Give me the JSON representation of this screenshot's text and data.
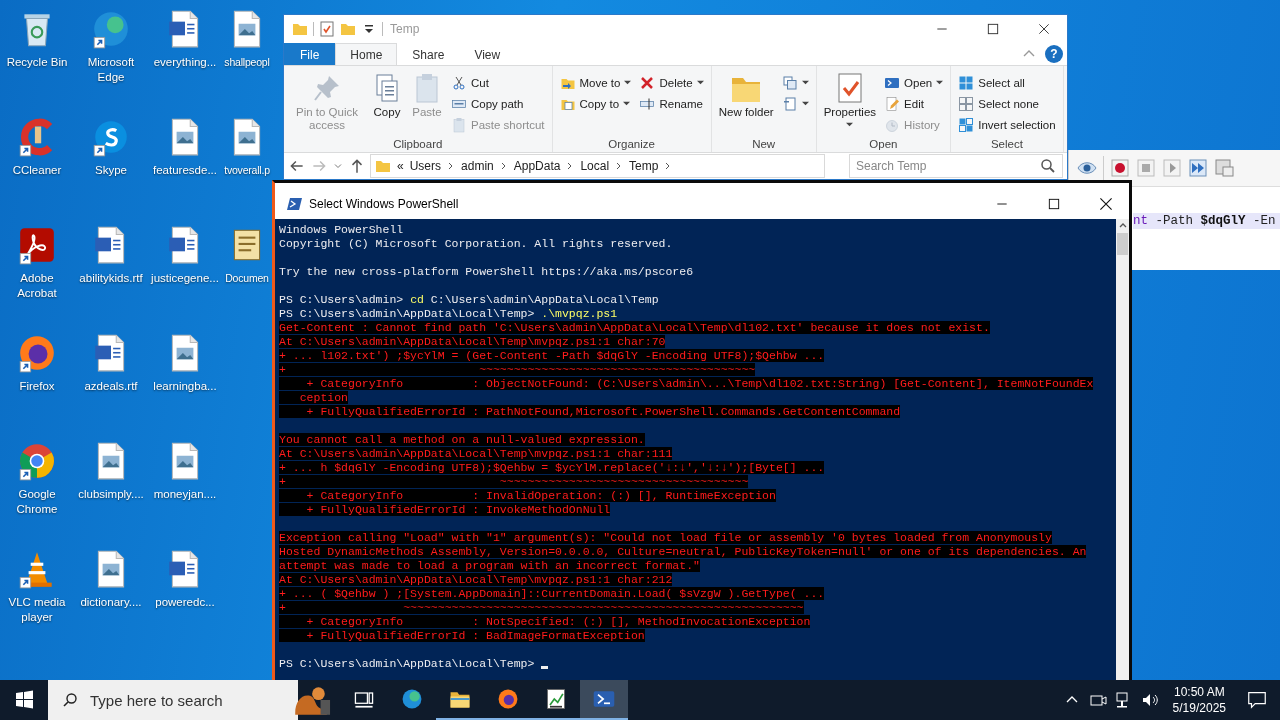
{
  "desktop": {
    "icons": [
      {
        "label": "Recycle Bin",
        "kind": "recycle",
        "shortcut": false
      },
      {
        "label": "CCleaner",
        "kind": "ccleaner",
        "shortcut": true
      },
      {
        "label": "Adobe Acrobat",
        "kind": "acrobat",
        "shortcut": true
      },
      {
        "label": "Firefox",
        "kind": "firefox",
        "shortcut": true
      },
      {
        "label": "Google Chrome",
        "kind": "chrome",
        "shortcut": true
      },
      {
        "label": "VLC media player",
        "kind": "vlc",
        "shortcut": true
      },
      {
        "label": "Microsoft Edge",
        "kind": "edge",
        "shortcut": true
      },
      {
        "label": "Skype",
        "kind": "skype",
        "shortcut": true
      },
      {
        "label": "abilitykids.rtf",
        "kind": "word",
        "shortcut": false
      },
      {
        "label": "azdeals.rtf",
        "kind": "word",
        "shortcut": false
      },
      {
        "label": "clubsimply....",
        "kind": "image",
        "shortcut": false
      },
      {
        "label": "dictionary....",
        "kind": "image",
        "shortcut": false
      },
      {
        "label": "everything...",
        "kind": "word",
        "shortcut": false
      },
      {
        "label": "featuresde...",
        "kind": "image",
        "shortcut": false
      },
      {
        "label": "justicegene...",
        "kind": "word",
        "shortcut": false
      },
      {
        "label": "learningba...",
        "kind": "image",
        "shortcut": false
      },
      {
        "label": "moneyjan....",
        "kind": "image",
        "shortcut": false
      },
      {
        "label": "poweredc...",
        "kind": "word",
        "shortcut": false
      },
      {
        "label": "shallpeopl",
        "kind": "image",
        "shortcut": false
      },
      {
        "label": "tvoverall.p",
        "kind": "image",
        "shortcut": false
      },
      {
        "label": "Documen",
        "kind": "script",
        "shortcut": false
      }
    ]
  },
  "explorer": {
    "title": "Temp",
    "tabs": [
      {
        "label": "File",
        "kind": "file",
        "selected": false
      },
      {
        "label": "Home",
        "kind": "tab",
        "selected": true
      },
      {
        "label": "Share",
        "kind": "tab",
        "selected": false
      },
      {
        "label": "View",
        "kind": "tab",
        "selected": false
      }
    ],
    "help": "?",
    "ribbon": [
      {
        "label": "Clipboard",
        "items": [
          {
            "label": "Pin to Quick access",
            "kind": "large",
            "disabled": true,
            "dropdown": false
          },
          {
            "label": "Copy",
            "kind": "large",
            "disabled": false,
            "dropdown": false
          },
          {
            "label": "Paste",
            "kind": "large",
            "disabled": true,
            "dropdown": false
          },
          {
            "label": "Cut",
            "kind": "small",
            "disabled": false,
            "dropdown": false
          },
          {
            "label": "Copy path",
            "kind": "small",
            "disabled": false,
            "dropdown": false
          },
          {
            "label": "Paste shortcut",
            "kind": "small",
            "disabled": true,
            "dropdown": false
          }
        ]
      },
      {
        "label": "Organize",
        "items": [
          {
            "label": "Move to",
            "kind": "small",
            "disabled": false,
            "dropdown": true
          },
          {
            "label": "Copy to",
            "kind": "small",
            "disabled": false,
            "dropdown": true
          },
          {
            "label": "Delete",
            "kind": "small",
            "disabled": false,
            "dropdown": true
          },
          {
            "label": "Rename",
            "kind": "small",
            "disabled": false,
            "dropdown": false
          }
        ]
      },
      {
        "label": "New",
        "items": [
          {
            "label": "New folder",
            "kind": "large",
            "disabled": false,
            "dropdown": false
          },
          {
            "kind": "small",
            "disabled": false,
            "dropdown": true
          },
          {
            "kind": "small",
            "disabled": false,
            "dropdown": true
          }
        ]
      },
      {
        "label": "Open",
        "items": [
          {
            "label": "Properties",
            "kind": "large",
            "disabled": false,
            "dropdown": true
          },
          {
            "label": "Open",
            "kind": "small",
            "disabled": false,
            "dropdown": true
          },
          {
            "label": "Edit",
            "kind": "small",
            "disabled": false,
            "dropdown": false
          },
          {
            "label": "History",
            "kind": "small",
            "disabled": true,
            "dropdown": false
          }
        ]
      },
      {
        "label": "Select",
        "items": [
          {
            "label": "Select all",
            "kind": "small",
            "disabled": false,
            "dropdown": false
          },
          {
            "label": "Select none",
            "kind": "small",
            "disabled": false,
            "dropdown": false
          },
          {
            "label": "Invert selection",
            "kind": "small",
            "disabled": false,
            "dropdown": false
          }
        ]
      }
    ],
    "address": {
      "overflow": "«",
      "crumbs": [
        "Users",
        "admin",
        "AppData",
        "Local",
        "Temp"
      ]
    },
    "search": {
      "placeholder": "Search Temp"
    }
  },
  "editor": {
    "code": [
      {
        "text": "nt",
        "kind": "keyword"
      },
      {
        "text": " -Path ",
        "kind": "plain"
      },
      {
        "text": "$dqGlY",
        "kind": "variable"
      },
      {
        "text": " -En",
        "kind": "plain"
      }
    ]
  },
  "powershell": {
    "title": "Select Windows PowerShell",
    "lines": [
      {
        "kind": "text",
        "text": "Windows PowerShell"
      },
      {
        "kind": "text",
        "text": "Copyright (C) Microsoft Corporation. All rights reserved."
      },
      {
        "kind": "blank"
      },
      {
        "kind": "text",
        "text": "Try the new cross-platform PowerShell https://aka.ms/pscore6"
      },
      {
        "kind": "blank"
      },
      {
        "kind": "prompt",
        "prompt": "PS C:\\Users\\admin>",
        "command": "cd",
        "args": "C:\\Users\\admin\\AppData\\Local\\Temp",
        "cursor": false
      },
      {
        "kind": "prompt",
        "prompt": "PS C:\\Users\\admin\\AppData\\Local\\Temp>",
        "command": ".\\mvpqz.ps1",
        "cursor": false
      },
      {
        "kind": "error",
        "text": "Get-Content : Cannot find path 'C:\\Users\\admin\\AppData\\Local\\Temp\\dl102.txt' because it does not exist."
      },
      {
        "kind": "error",
        "text": "At C:\\Users\\admin\\AppData\\Local\\Temp\\mvpqz.ps1:1 char:70"
      },
      {
        "kind": "error",
        "text": "+ ... l102.txt') ;$ycYlM = (Get-Content -Path $dqGlY -Encoding UTF8);$Qehbw ..."
      },
      {
        "kind": "error",
        "text": "+                            ~~~~~~~~~~~~~~~~~~~~~~~~~~~~~~~~~~~~~~~~"
      },
      {
        "kind": "error",
        "text": "    + CategoryInfo          : ObjectNotFound: (C:\\Users\\admin\\...\\Temp\\dl102.txt:String) [Get-Content], ItemNotFoundEx"
      },
      {
        "kind": "error",
        "text": "   ception"
      },
      {
        "kind": "error",
        "text": "    + FullyQualifiedErrorId : PathNotFound,Microsoft.PowerShell.Commands.GetContentCommand"
      },
      {
        "kind": "blank"
      },
      {
        "kind": "error",
        "text": "You cannot call a method on a null-valued expression."
      },
      {
        "kind": "error",
        "text": "At C:\\Users\\admin\\AppData\\Local\\Temp\\mvpqz.ps1:1 char:111"
      },
      {
        "kind": "error",
        "text": "+ ... h $dqGlY -Encoding UTF8);$Qehbw = $ycYlM.replace('↓:↓','↓:↓');[Byte[] ..."
      },
      {
        "kind": "error",
        "text": "+                               ~~~~~~~~~~~~~~~~~~~~~~~~~~~~~~~~~~~~"
      },
      {
        "kind": "error",
        "text": "    + CategoryInfo          : InvalidOperation: (:) [], RuntimeException"
      },
      {
        "kind": "error",
        "text": "    + FullyQualifiedErrorId : InvokeMethodOnNull"
      },
      {
        "kind": "blank"
      },
      {
        "kind": "error",
        "text": "Exception calling \"Load\" with \"1\" argument(s): \"Could not load file or assembly '0 bytes loaded from Anonymously"
      },
      {
        "kind": "error",
        "text": "Hosted DynamicMethods Assembly, Version=0.0.0.0, Culture=neutral, PublicKeyToken=null' or one of its dependencies. An"
      },
      {
        "kind": "error",
        "text": "attempt was made to load a program with an incorrect format.\""
      },
      {
        "kind": "error",
        "text": "At C:\\Users\\admin\\AppData\\Local\\Temp\\mvpqz.ps1:1 char:212"
      },
      {
        "kind": "error",
        "text": "+ ... ( $Qehbw ) ;[System.AppDomain]::CurrentDomain.Load( $sVzgW ).GetType( ..."
      },
      {
        "kind": "error",
        "text": "+                 ~~~~~~~~~~~~~~~~~~~~~~~~~~~~~~~~~~~~~~~~~~~~~~~~~~~~~~~~~~"
      },
      {
        "kind": "error",
        "text": "    + CategoryInfo          : NotSpecified: (:) [], MethodInvocationException"
      },
      {
        "kind": "error",
        "text": "    + FullyQualifiedErrorId : BadImageFormatException"
      },
      {
        "kind": "blank"
      },
      {
        "kind": "prompt",
        "prompt": "PS C:\\Users\\admin\\AppData\\Local\\Temp>",
        "cursor": true
      }
    ]
  },
  "taskbar": {
    "search": {
      "placeholder": "Type here to search"
    },
    "apps": [
      {
        "running": false,
        "selected": false
      },
      {
        "running": false,
        "selected": false
      },
      {
        "running": true,
        "selected": false
      },
      {
        "running": true,
        "selected": false
      },
      {
        "running": true,
        "selected": false
      },
      {
        "running": true,
        "selected": true
      }
    ],
    "time": "10:50 AM",
    "date": "5/19/2025"
  }
}
